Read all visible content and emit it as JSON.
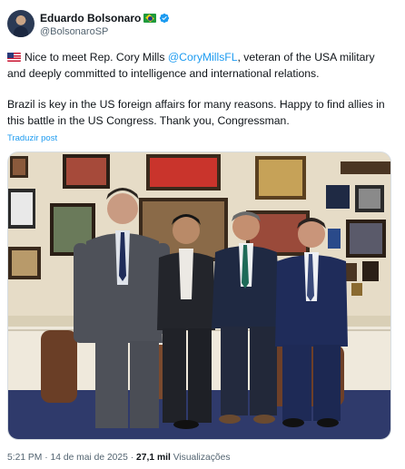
{
  "author": {
    "name": "Eduardo Bolsonaro",
    "handle": "@BolsonaroSP",
    "verified_color": "#1d9bf0"
  },
  "tweet": {
    "line1_before": "Nice to meet Rep. Cory Mills ",
    "mention": "@CoryMillsFL",
    "line1_after": ", veteran of the USA military and deeply committed to intelligence and international relations.",
    "paragraph2": "Brazil is key in the US foreign affairs for many reasons. Happy to find allies in this battle in the US Congress. Thank you, Congressman.",
    "translate_label": "Traduzir post"
  },
  "meta": {
    "time": "5:21 PM",
    "separator": "·",
    "date": "14 de mai de 2025",
    "views_count": "27,1 mil",
    "views_label": "Visualizações"
  },
  "colors": {
    "link": "#1d9bf0",
    "secondary_text": "#536471"
  },
  "icons": [
    "avatar",
    "brazil-flag-icon",
    "verified-badge-icon",
    "us-flag-icon",
    "more-icon"
  ]
}
